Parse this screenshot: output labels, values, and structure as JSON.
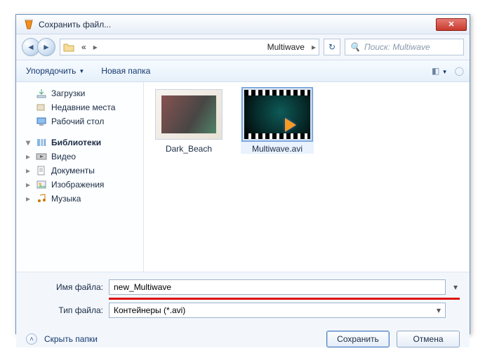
{
  "window": {
    "title": "Сохранить файл..."
  },
  "nav": {
    "breadcrumb_prefix": "«",
    "breadcrumb_current": "Multiwave",
    "search_placeholder": "Поиск: Multiwave"
  },
  "toolbar": {
    "organize": "Упорядочить",
    "new_folder": "Новая папка"
  },
  "tree": {
    "downloads": "Загрузки",
    "recent": "Недавние места",
    "desktop": "Рабочий стол",
    "libraries": "Библиотеки",
    "video": "Видео",
    "documents": "Документы",
    "pictures": "Изображения",
    "music": "Музыка"
  },
  "files": {
    "folder1": "Dark_Beach",
    "file1": "Multiwave.avi"
  },
  "form": {
    "filename_label": "Имя файла:",
    "filename_value": "new_Multiwave",
    "filetype_label": "Тип файла:",
    "filetype_value": "Контейнеры (*.avi)"
  },
  "footer": {
    "hide_folders": "Скрыть папки",
    "save": "Сохранить",
    "cancel": "Отмена"
  }
}
